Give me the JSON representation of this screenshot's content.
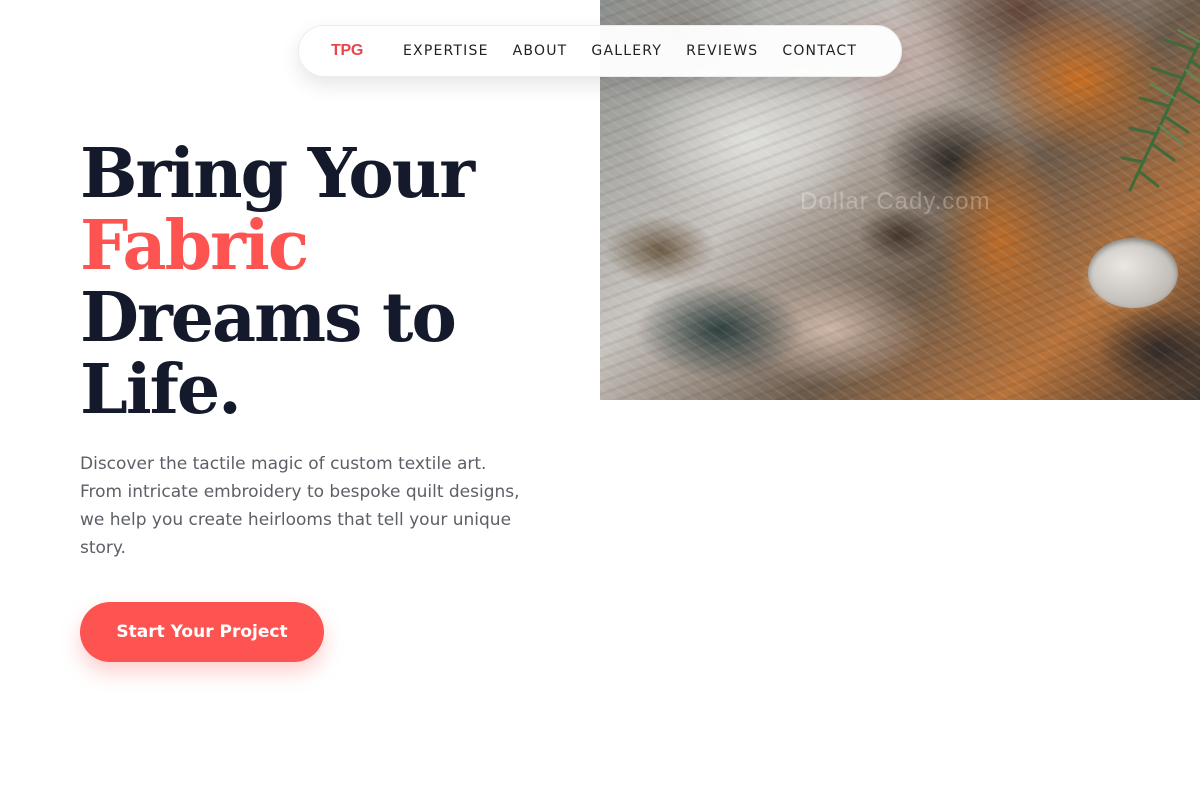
{
  "nav": {
    "logo": "TPG",
    "links": [
      "EXPERTISE",
      "ABOUT",
      "GALLERY",
      "REVIEWS",
      "CONTACT"
    ]
  },
  "hero": {
    "title_line1": "Bring Your",
    "title_accent": "Fabric",
    "title_line3": "Dreams to",
    "title_line4": "Life.",
    "description": "Discover the tactile magic of custom textile art. From intricate embroidery to bespoke quilt designs, we help you create heirlooms that tell your unique story.",
    "cta_label": "Start Your Project",
    "image_watermark": "Dollar Cady.com"
  },
  "colors": {
    "accent": "#fd5452",
    "heading": "#141a2b",
    "body_text": "#5c5f66",
    "logo": "#e8474a"
  },
  "icons": {
    "hero_image": "textured-paint-image"
  }
}
